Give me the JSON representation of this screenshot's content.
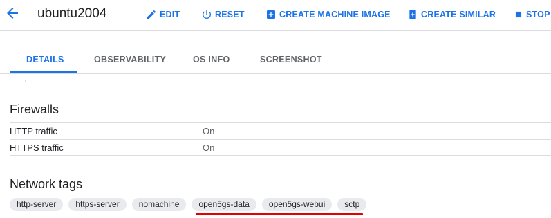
{
  "header": {
    "title": "ubuntu2004",
    "actions": {
      "edit": "EDIT",
      "reset": "RESET",
      "create_machine_image": "CREATE MACHINE IMAGE",
      "create_similar": "CREATE SIMILAR",
      "stop": "STOP"
    }
  },
  "tabs": [
    {
      "label": "DETAILS",
      "active": true
    },
    {
      "label": "OBSERVABILITY",
      "active": false
    },
    {
      "label": "OS INFO",
      "active": false
    },
    {
      "label": "SCREENSHOT",
      "active": false
    }
  ],
  "firewalls": {
    "title": "Firewalls",
    "rows": [
      {
        "label": "HTTP traffic",
        "value": "On"
      },
      {
        "label": "HTTPS traffic",
        "value": "On"
      }
    ]
  },
  "network_tags": {
    "title": "Network tags",
    "tags": [
      "http-server",
      "https-server",
      "nomachine",
      "open5gs-data",
      "open5gs-webui",
      "sctp"
    ],
    "highlighted": [
      "open5gs-data",
      "open5gs-webui",
      "sctp"
    ]
  },
  "colors": {
    "accent": "#1a73e8",
    "text": "#202124",
    "muted": "#5f6368",
    "divider": "#dadce0",
    "chip_bg": "#e8eaed",
    "highlight_underline": "#e60000"
  },
  "icons": [
    "arrow-back-icon",
    "pencil-icon",
    "power-icon",
    "add-box-icon",
    "copy-add-icon",
    "stop-icon"
  ]
}
